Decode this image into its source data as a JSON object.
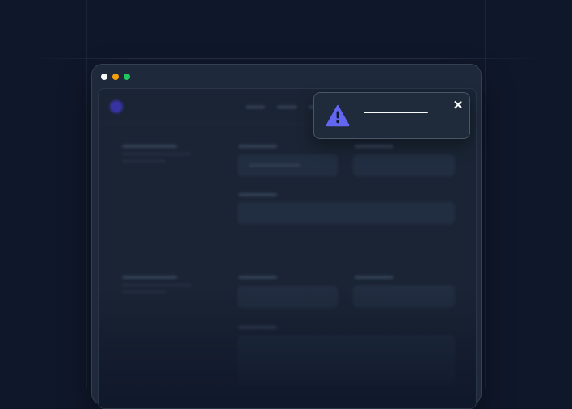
{
  "window": {
    "controls": [
      "close",
      "minimize",
      "maximize"
    ],
    "control_colors": {
      "close": "#f8fafc",
      "minimize": "#f59e0b",
      "maximize": "#22c55e"
    }
  },
  "app": {
    "logo_color": "#4338ca",
    "content_state": "blurred-placeholder"
  },
  "toast": {
    "type": "warning",
    "icon": "warning-triangle-icon",
    "accent": "#6366f1",
    "close_glyph": "✕"
  },
  "colors": {
    "background": "#0f172a",
    "window": "#1e293b",
    "toast_border": "#4b5568"
  }
}
